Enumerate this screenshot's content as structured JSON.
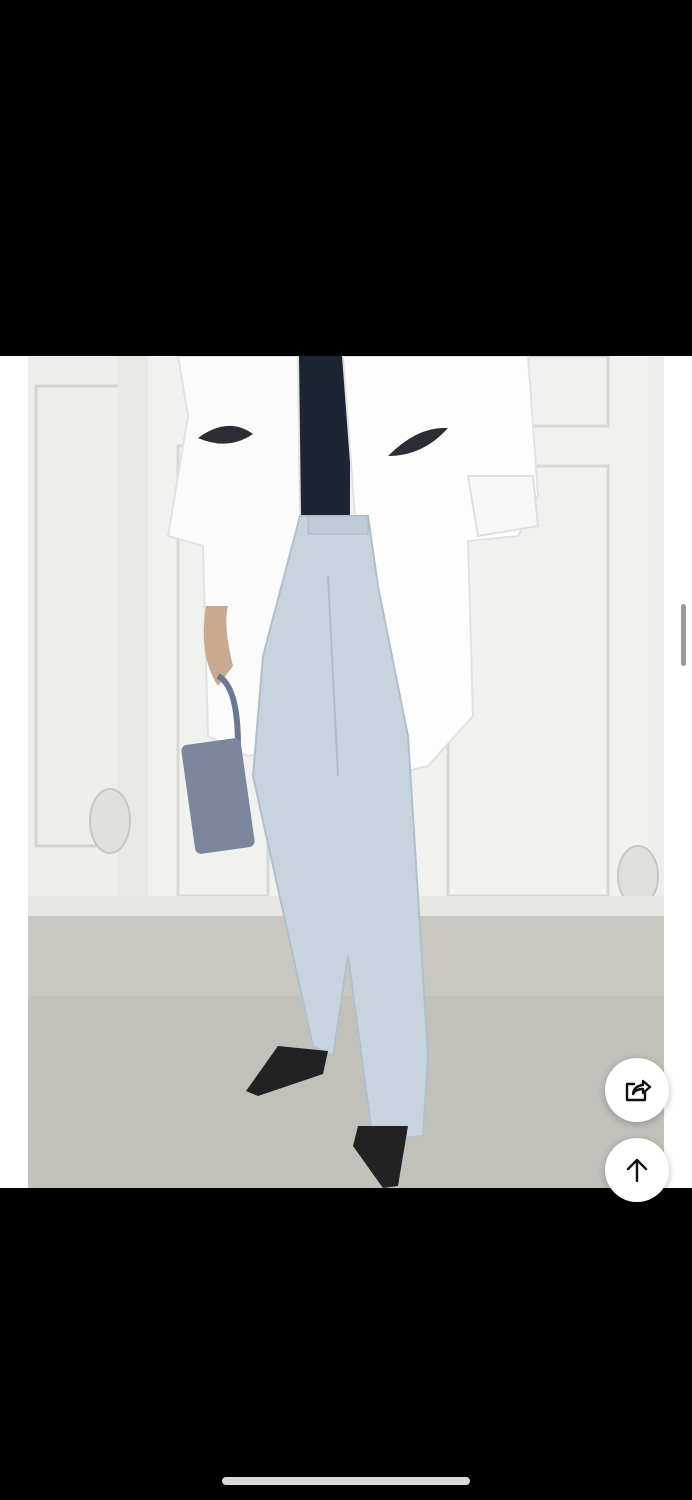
{
  "image": {
    "alt": "",
    "background_color": "#ffffff"
  },
  "actions": {
    "share_icon": "share-icon",
    "scroll_top_icon": "arrow-up-icon"
  },
  "colors": {
    "page_background": "#000000",
    "fab_background": "#ffffff",
    "icon_stroke": "#111111",
    "home_indicator": "#d9d9d9"
  }
}
